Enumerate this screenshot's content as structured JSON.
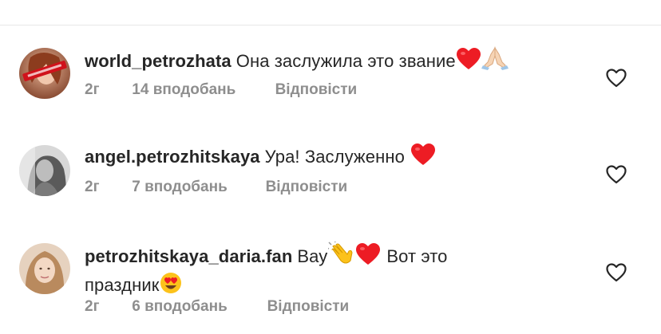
{
  "comments": [
    {
      "username": "world_petrozhata",
      "text": "Она заслужила это звание",
      "time": "2г",
      "likes": "14 вподобань",
      "reply": "Відповісти"
    },
    {
      "username": "angel.petrozhitskaya",
      "text": "Ура! Заслуженно",
      "time": "2г",
      "likes": "7 вподобань",
      "reply": "Відповісти"
    },
    {
      "username": "petrozhitskaya_daria.fan",
      "text_part1": "Вау",
      "text_part2": "Вот это",
      "text_line2": "праздник",
      "time": "2г",
      "likes": "6 вподобань",
      "reply": "Відповісти"
    }
  ],
  "icons": {
    "heart_emoji": "red-heart-emoji",
    "praying_hands_emoji": "folded-hands-emoji",
    "clapping_emoji": "clapping-hands-emoji",
    "heart_eyes_emoji": "heart-eyes-emoji",
    "like": "heart-outline-icon"
  },
  "colors": {
    "text": "#262626",
    "meta": "#8e8e8e",
    "heart": "#ed1c24",
    "divider": "#e8e8e8"
  }
}
